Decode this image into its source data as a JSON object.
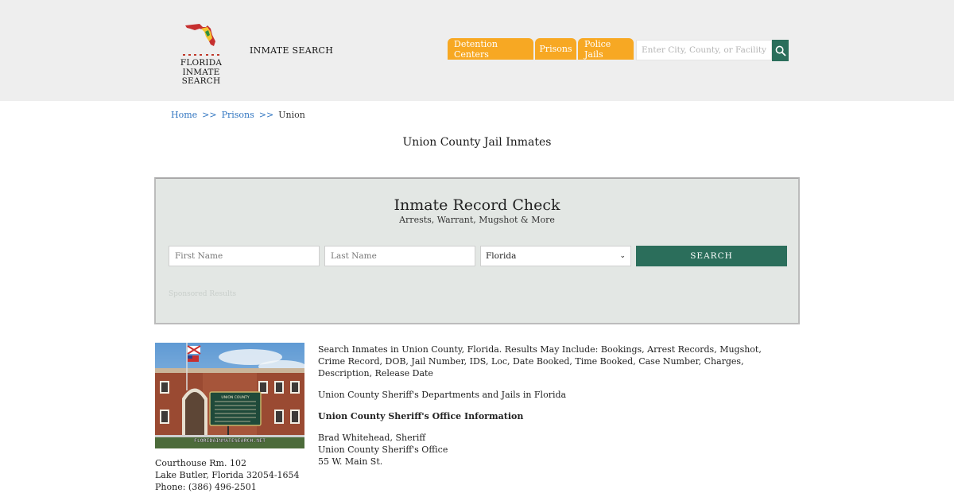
{
  "header": {
    "logo_line1": "FLORIDA",
    "logo_line2": "INMATE SEARCH",
    "brand_link": "INMATE SEARCH",
    "nav": [
      "Detention Centers",
      "Prisons",
      "Police Jails"
    ],
    "search_placeholder": "Enter City, County, or Facility",
    "accent": "#f7a823",
    "brand_green": "#2b6e5b"
  },
  "breadcrumb": {
    "home": "Home",
    "sep": ">>",
    "prisons": "Prisons",
    "current": "Union"
  },
  "page_title": "Union County Jail Inmates",
  "record_check": {
    "title": "Inmate Record Check",
    "subtitle": "Arrests, Warrant, Mugshot & More",
    "first_placeholder": "First Name",
    "last_placeholder": "Last Name",
    "state_value": "Florida",
    "button": "SEARCH",
    "sponsored": "Sponsored Results"
  },
  "photo": {
    "watermark": "FLORIDAINMATESEARCH.NET",
    "sign_text": "UNION COUNTY"
  },
  "address": {
    "line1": "Courthouse Rm. 102",
    "line2": "Lake Butler, Florida 32054-1654",
    "line3": "Phone: (386) 496-2501"
  },
  "content": {
    "intro": "Search Inmates in Union County, Florida. Results May Include: Bookings, Arrest Records, Mugshot, Crime Record, DOB, Jail Number, IDS, Loc, Date Booked, Time Booked, Case Number, Charges, Description, Release Date",
    "departments": "Union County Sheriff's Departments and Jails in Florida",
    "office_heading": "Union County Sheriff's Office Information",
    "sheriff": "Brad Whitehead, Sheriff",
    "office": "Union County Sheriff's Office",
    "street": "55 W. Main St."
  }
}
